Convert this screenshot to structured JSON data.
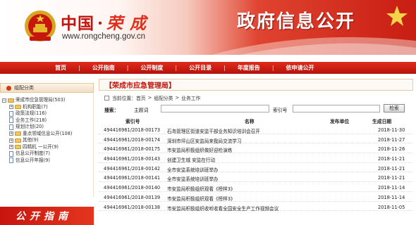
{
  "header": {
    "site_name_1": "中国",
    "site_name_dot": "·",
    "site_name_2": "荣 成",
    "site_url": "www.rongcheng.gov.cn",
    "title": "政府信息公开"
  },
  "colors": {
    "brand_red": "#c1140e",
    "nav_red": "#d0200f",
    "title_red": "#c2140c"
  },
  "nav": [
    {
      "label": "首页"
    },
    {
      "label": "公开指南"
    },
    {
      "label": "公开制度"
    },
    {
      "label": "公开目录"
    },
    {
      "label": "年度报告"
    },
    {
      "label": "依申请公开"
    }
  ],
  "sidebar": {
    "heading": "组配分类",
    "items": [
      {
        "label": "荣成市应急管理局(503)",
        "type": "root"
      },
      {
        "label": "机构职能(7)",
        "type": "folder-plus"
      },
      {
        "label": "政策法规(116)",
        "type": "doc"
      },
      {
        "label": "业务工作(218)",
        "type": "doc"
      },
      {
        "label": "规划计划(20)",
        "type": "doc"
      },
      {
        "label": "重点领域信息公开(108)",
        "type": "folder-plus"
      },
      {
        "label": "其他(9)",
        "type": "folder-plus"
      },
      {
        "label": "四精机 一公开(9)",
        "type": "folder-plus"
      },
      {
        "label": "信息公开制度(7)",
        "type": "doc"
      },
      {
        "label": "信息公开年报(9)",
        "type": "doc"
      }
    ],
    "guide_banner": "公开指南"
  },
  "main": {
    "org_title": "【荣成市应急管理局】",
    "breadcrumb": {
      "prefix": "当前位置：",
      "items": [
        "首页",
        "组配分类",
        "业务工作"
      ]
    },
    "search": {
      "label": "搜索：",
      "field1_label": "主题词",
      "field2_label": "索引号",
      "button": "检索"
    },
    "table": {
      "headers": {
        "index": "索引号",
        "name": "名称",
        "publisher": "发布单位",
        "date": "生成日期"
      },
      "rows": [
        {
          "index": "494416961/2018-00173",
          "name": "石岛管理区街道安监干部业务知识培训会召开",
          "date": "2018-11-30"
        },
        {
          "index": "494416961/2018-00174",
          "name": "深圳市坪山区安监局来我局交流学习",
          "date": "2018-11-27"
        },
        {
          "index": "494416961/2018-00175",
          "name": "市安监局积极组织做好迎检演练",
          "date": "2018-11-26"
        },
        {
          "index": "494416961/2018-00143",
          "name": "创建卫生城 安监在行动",
          "date": "2018-11-21"
        },
        {
          "index": "494416961/2018-00142",
          "name": "全市安监系统培训班举办",
          "date": "2018-11-21"
        },
        {
          "index": "494416961/2018-00141",
          "name": "全市安监系统培训班举办",
          "date": "2018-11-21"
        },
        {
          "index": "494416961/2018-00140",
          "name": "市安监局积极组织观看《榜样3》",
          "date": "2018-11-14"
        },
        {
          "index": "494416961/2018-00139",
          "name": "市安监局积极组织观看《榜样3》",
          "date": "2018-11-14"
        },
        {
          "index": "494416961/2018-00138",
          "name": "市安监局积极组织收听收看全国安全生产工作视频会议",
          "date": "2018-11-05"
        }
      ]
    }
  }
}
